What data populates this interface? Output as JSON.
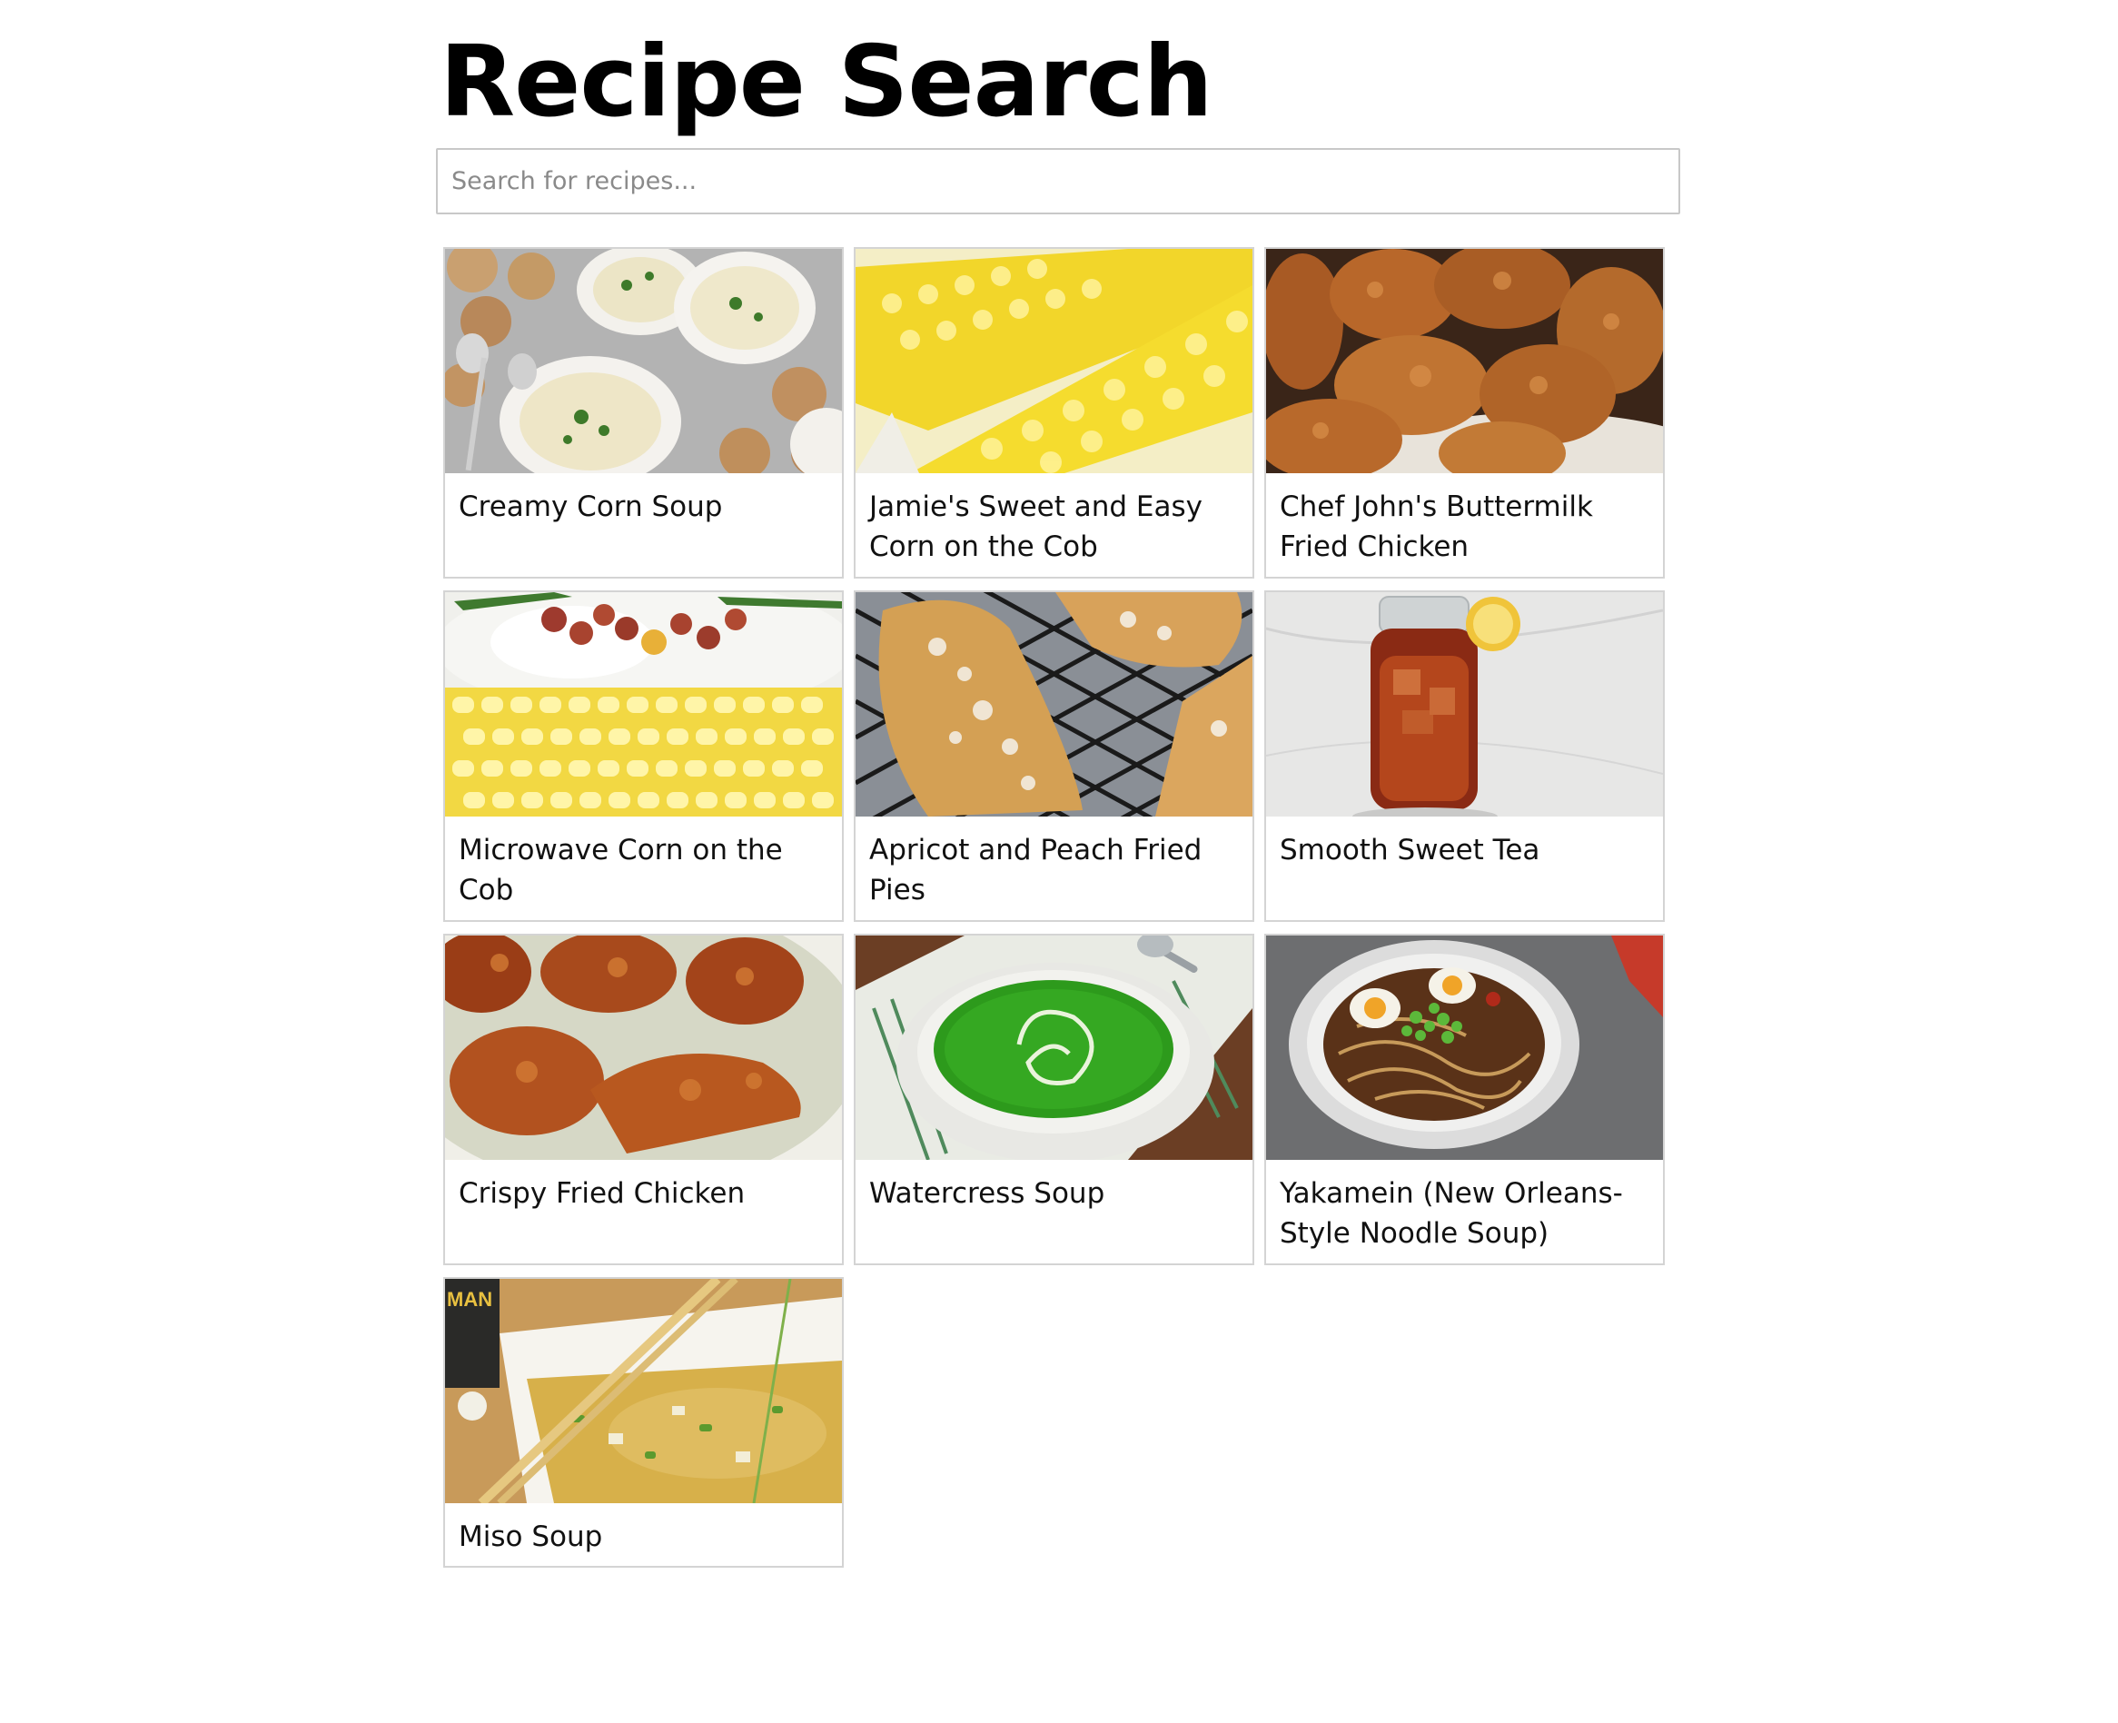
{
  "header": {
    "title": "Recipe Search"
  },
  "search": {
    "placeholder": "Search for recipes...",
    "value": ""
  },
  "recipes": [
    {
      "title": "Creamy Corn Soup",
      "image": "creamy-corn-soup-photo"
    },
    {
      "title": "Jamie's Sweet and Easy Corn on the Cob",
      "image": "corn-on-cob-photo"
    },
    {
      "title": "Chef John's Buttermilk Fried Chicken",
      "image": "fried-chicken-photo"
    },
    {
      "title": "Microwave Corn on the Cob",
      "image": "microwave-corn-photo"
    },
    {
      "title": "Apricot and Peach Fried Pies",
      "image": "fried-pies-photo"
    },
    {
      "title": "Smooth Sweet Tea",
      "image": "sweet-tea-photo"
    },
    {
      "title": "Crispy Fried Chicken",
      "image": "crispy-chicken-photo"
    },
    {
      "title": "Watercress Soup",
      "image": "watercress-soup-photo"
    },
    {
      "title": "Yakamein (New Orleans-Style Noodle Soup)",
      "image": "yakamein-photo"
    },
    {
      "title": "Miso Soup",
      "image": "miso-soup-photo"
    }
  ]
}
